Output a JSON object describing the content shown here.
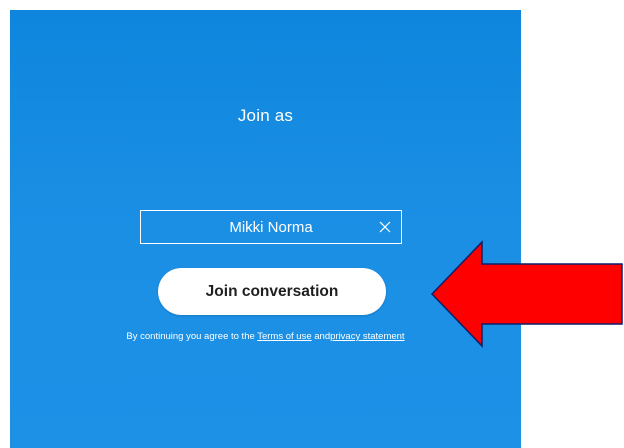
{
  "join": {
    "title": "Join as",
    "name_value": "Mikki Norma",
    "clear_icon": "close-icon",
    "join_button_label": "Join conversation",
    "legal_prefix": "By continuing you agree to the",
    "terms_link": "Terms of use",
    "legal_and": " and",
    "privacy_link": "privacy statement"
  },
  "annotation": {
    "arrow_color": "#ff0000",
    "arrow_icon": "left-arrow-icon"
  },
  "colors": {
    "panel_blue": "#1b8fe4",
    "button_bg": "#ffffff"
  }
}
